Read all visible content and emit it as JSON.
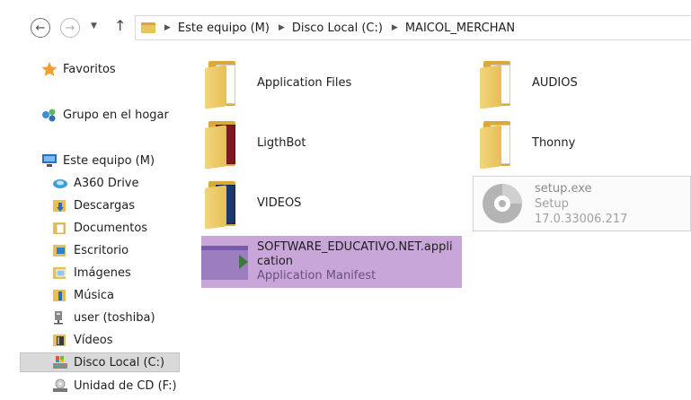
{
  "address": {
    "crumbs": [
      "Este equipo (M)",
      "Disco Local (C:)",
      "MAICOL_MERCHAN"
    ]
  },
  "nav": {
    "favorites": "Favoritos",
    "homegroup": "Grupo en el hogar",
    "this_pc": "Este equipo (M)",
    "items": [
      "A360 Drive",
      "Descargas",
      "Documentos",
      "Escritorio",
      "Imágenes",
      "Música",
      "user (toshiba)",
      "Vídeos",
      "Disco Local (C:)",
      "Unidad de CD (F:)"
    ]
  },
  "files": {
    "app_files": "Application Files",
    "audios": "AUDIOS",
    "ligthbot": "LigthBot",
    "thonny": "Thonny",
    "videos": "VIDEOS",
    "setup_name": "setup.exe",
    "setup_type": "Setup",
    "setup_version": "17.0.33006.217",
    "manifest_name_1": "SOFTWARE_EDUCATIVO.NET.appli",
    "manifest_name_2": "cation",
    "manifest_type": "Application Manifest"
  },
  "colors": {
    "selection": "#c9a6d9",
    "folder": "#e7bf55",
    "star": "#f0a030"
  }
}
